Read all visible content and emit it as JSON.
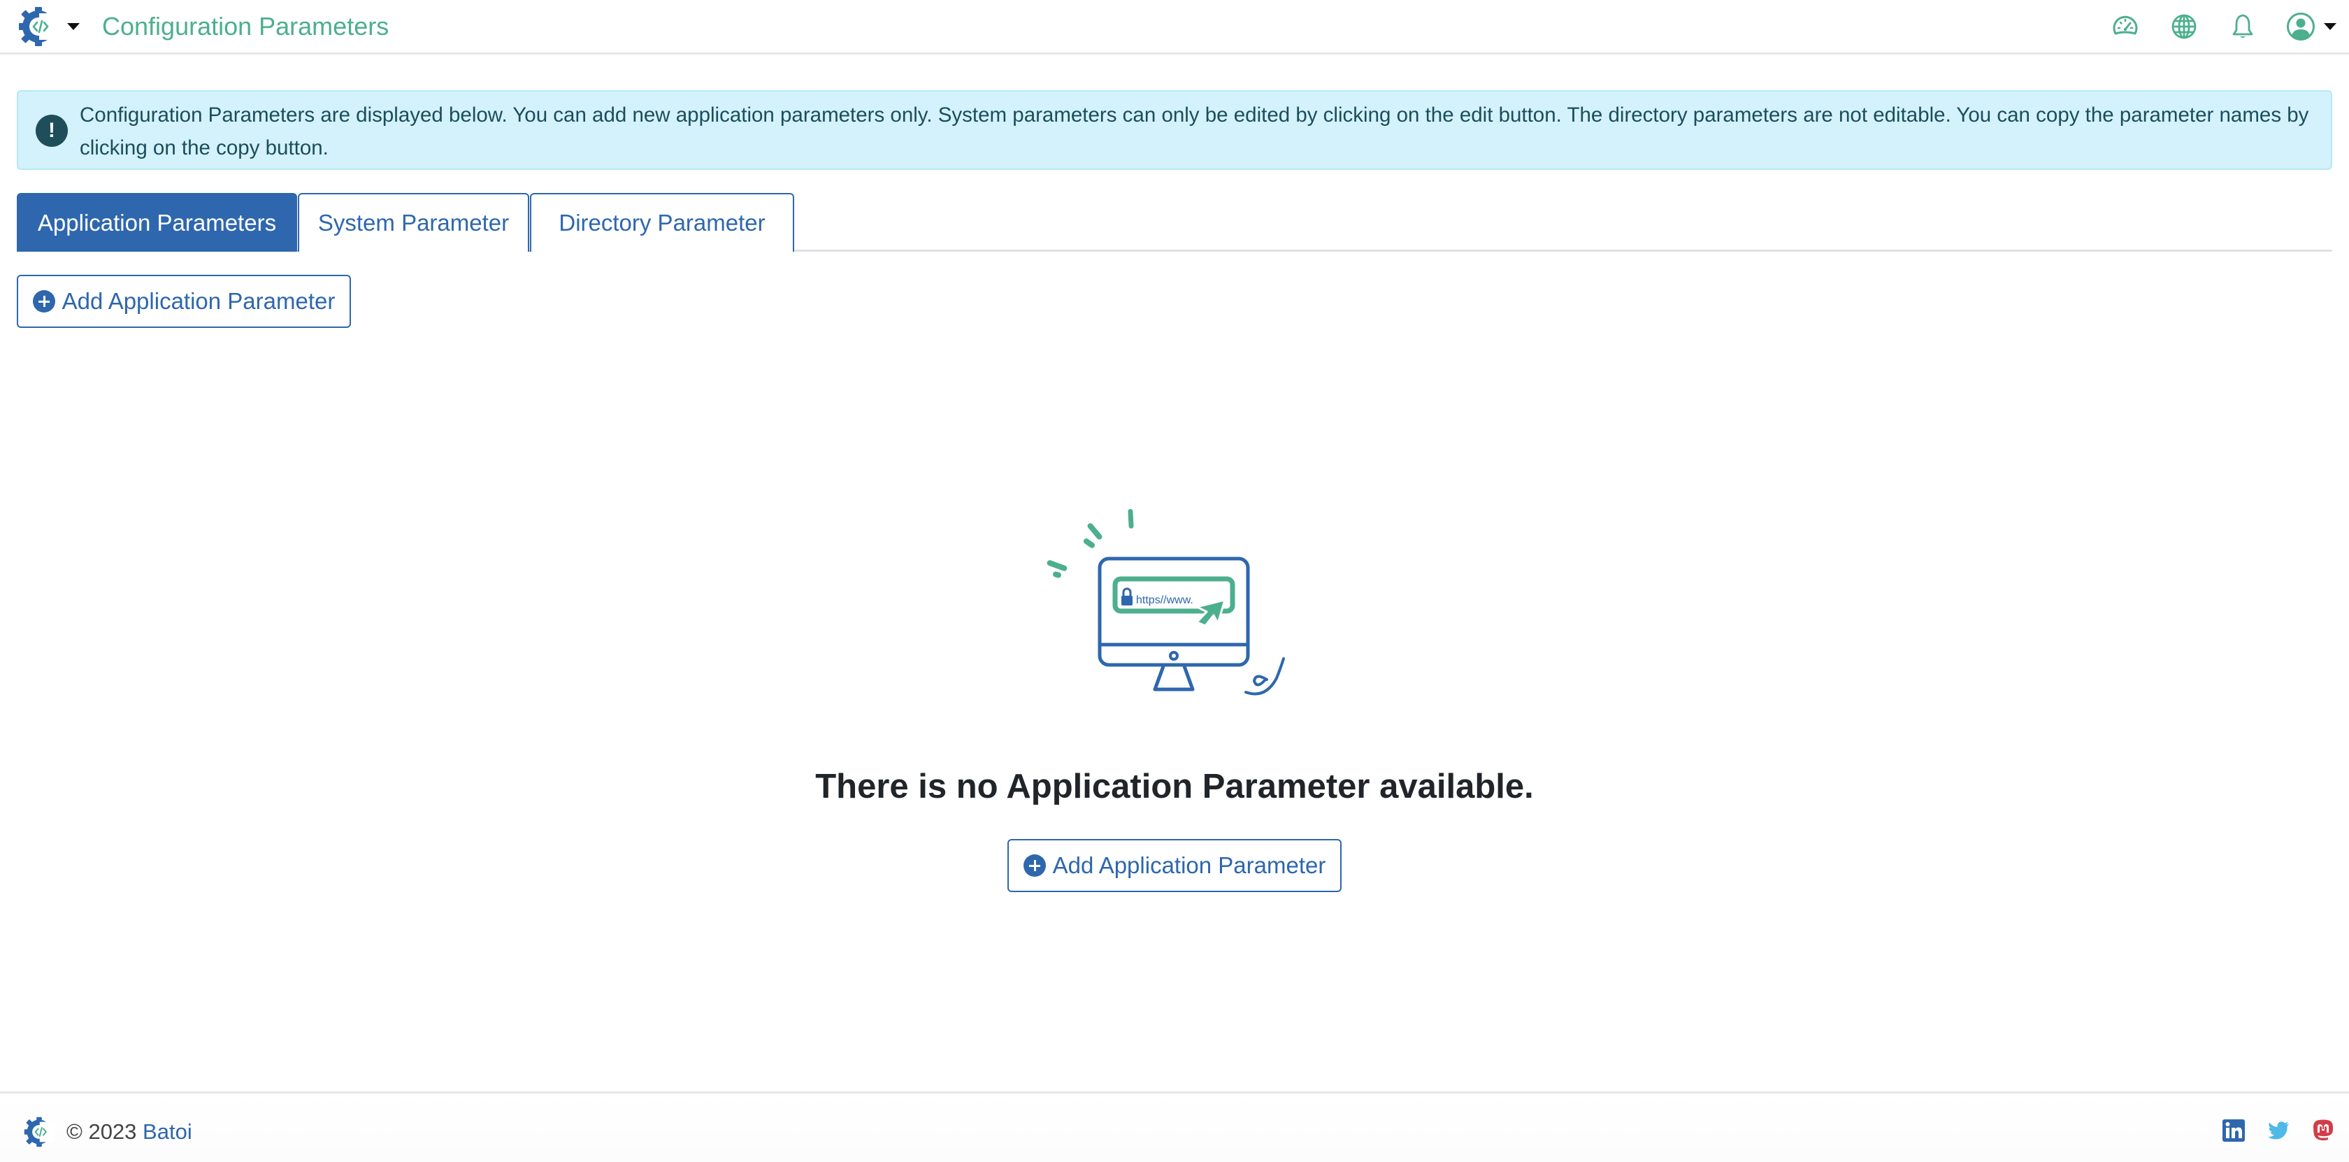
{
  "header": {
    "title": "Configuration Parameters",
    "icons": [
      "dashboard-icon",
      "globe-icon",
      "bell-icon",
      "user-icon"
    ],
    "accent_color": "#4caf8e"
  },
  "alert": {
    "icon": "exclamation-icon",
    "text": "Configuration Parameters are displayed below. You can add new application parameters only. System parameters can only be edited by clicking on the edit button. The directory parameters are not editable. You can copy the parameter names by clicking on the copy button."
  },
  "tabs": [
    {
      "label": "Application Parameters",
      "active": true
    },
    {
      "label": "System Parameter",
      "active": false
    },
    {
      "label": "Directory Parameter",
      "active": false
    }
  ],
  "toolbar": {
    "add_button_label": "Add Application Parameter"
  },
  "empty_state": {
    "illustration_url_text": "https//www.",
    "message": "There is no Application Parameter available.",
    "add_button_label": "Add Application Parameter"
  },
  "footer": {
    "copyright": "© 2023",
    "brand": "Batoi",
    "socials": [
      "linkedin-icon",
      "twitter-icon",
      "mastodon-icon"
    ]
  },
  "colors": {
    "primary": "#2e67ad",
    "accent": "#4caf8e",
    "alert_bg": "#d4f2fb",
    "alert_text": "#1b4d5c"
  }
}
